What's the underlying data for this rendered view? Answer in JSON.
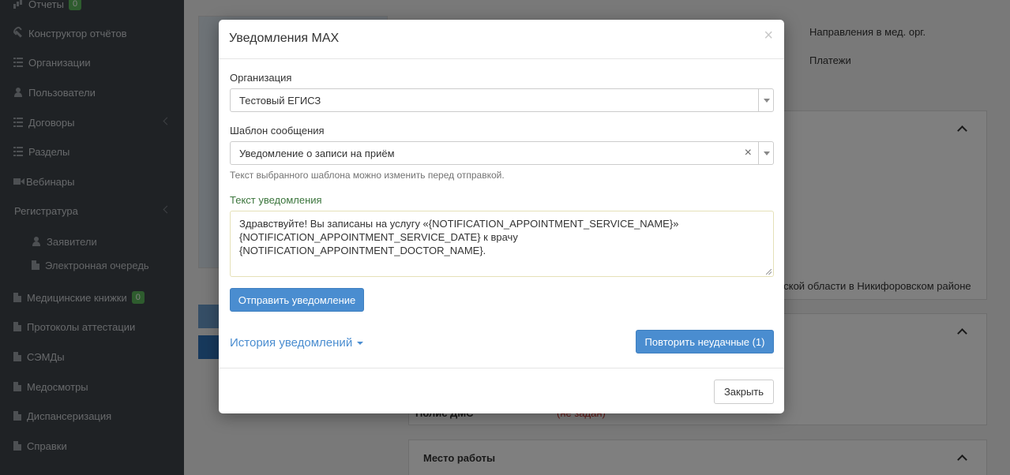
{
  "sidebar": {
    "items": [
      {
        "label": "Отчеты",
        "icon": "bar-chart-icon",
        "badge": "0"
      },
      {
        "label": "Конструктор отчётов",
        "icon": "wrench-icon"
      },
      {
        "label": "Организации",
        "icon": "list-icon"
      },
      {
        "label": "Пользователи",
        "icon": "user-icon"
      },
      {
        "label": "Договоры",
        "icon": "list-icon"
      },
      {
        "label": "Разделы",
        "icon": "list-icon"
      },
      {
        "label": "Вебинары",
        "icon": "video-icon"
      },
      {
        "label": "Регистратура"
      },
      {
        "label": "Заявители",
        "icon": "user-icon"
      },
      {
        "label": "Электронная очередь",
        "icon": "document-icon"
      },
      {
        "label": "Медицинские книжки",
        "icon": "document-icon",
        "badge": "0"
      },
      {
        "label": "Протоколы аттестации",
        "icon": "document-icon"
      },
      {
        "label": "СЭМДы",
        "icon": "document-icon"
      },
      {
        "label": "Медосмотры",
        "icon": "document-icon"
      },
      {
        "label": "Диспансеризация",
        "icon": "document-icon"
      },
      {
        "label": "Справки",
        "icon": "document-icon"
      }
    ]
  },
  "background": {
    "links": [
      "Направления в мед. орг.",
      "Платежи"
    ],
    "address_fragment": "аской области в Никифоровском районе",
    "field_label": "Полис ДМС",
    "field_value": "(не задан)",
    "section_title": "Место работы"
  },
  "modal": {
    "title": "Уведомления MAX",
    "close_glyph": "×",
    "organization_label": "Организация",
    "organization_value": "Тестовый ЕГИСЗ",
    "template_label": "Шаблон сообщения",
    "template_value": "Уведомление о записи на приём",
    "template_clear_glyph": "×",
    "template_help": "Текст выбранного шаблона можно изменить перед отправкой.",
    "text_label": "Текст уведомления",
    "text_value": "Здравствуйте! Вы записаны на услугу «{NOTIFICATION_APPOINTMENT_SERVICE_NAME}» {NOTIFICATION_APPOINTMENT_SERVICE_DATE} к врачу {NOTIFICATION_APPOINTMENT_DOCTOR_NAME}.",
    "send_button": "Отправить уведомление",
    "history_link": "История уведомлений",
    "retry_button": "Повторить неудачные (1)",
    "close_button": "Закрыть"
  },
  "colors": {
    "primary": "#4a8dd0",
    "sidebar_bg": "#3f444a",
    "success_badge": "#5cb85c",
    "label_success": "#3c763d"
  }
}
